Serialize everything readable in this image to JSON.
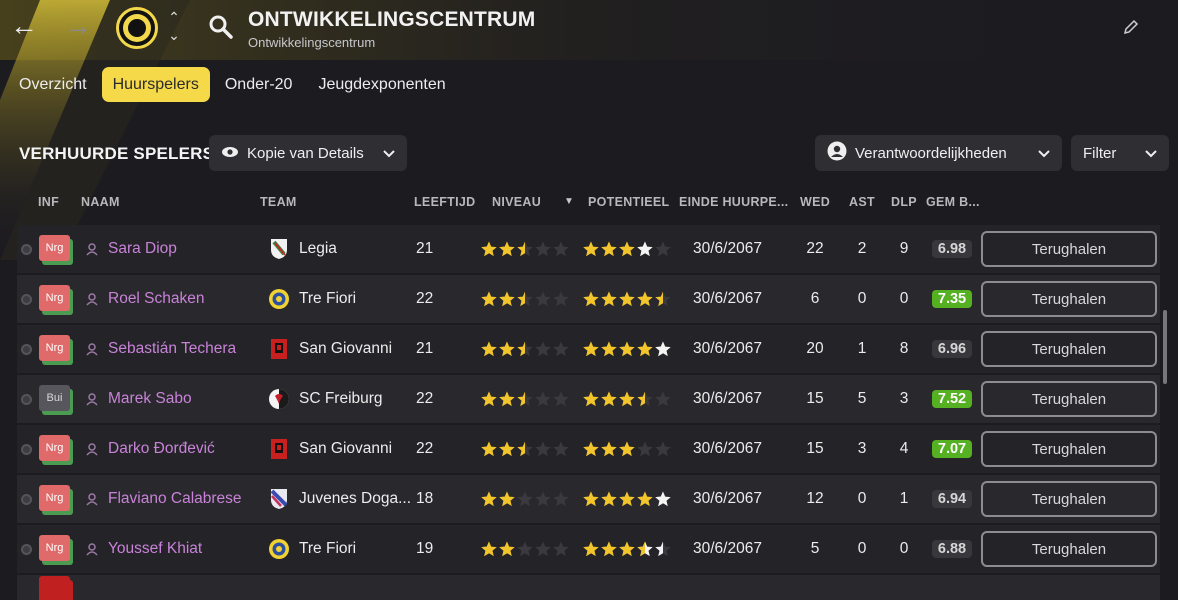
{
  "header": {
    "title": "ONTWIKKELINGSCENTRUM",
    "subtitle": "Ontwikkelingscentrum"
  },
  "tabs": [
    {
      "label": "Overzicht",
      "active": false
    },
    {
      "label": "Huurspelers",
      "active": true
    },
    {
      "label": "Onder-20",
      "active": false
    },
    {
      "label": "Jeugdexponenten",
      "active": false
    }
  ],
  "section": {
    "title": "VERHUURDE SPELERS",
    "view_label": "Kopie van Details",
    "responsibilities_label": "Verantwoordelijkheden",
    "filter_label": "Filter"
  },
  "columns": {
    "inf": "INF",
    "naam": "NAAM",
    "team": "TEAM",
    "leeftijd": "LEEFTIJD",
    "niveau": "NIVEAU",
    "potentieel": "POTENTIEEL",
    "einde": "EINDE HUURPE...",
    "wed": "WED",
    "ast": "AST",
    "dlp": "DLP",
    "gem": "GEM B..."
  },
  "recall_label": "Terughalen",
  "colors": {
    "accent": "#f5d949",
    "name": "#c883d8",
    "rating_good": "#55b022",
    "badge_red": "#e06a6a"
  },
  "players": [
    {
      "badge": "Nrg",
      "name": "Sara Diop",
      "team": "Legia",
      "crest": "legia-crest-icon",
      "age": "21",
      "niveau": 2.5,
      "potentieel": 4,
      "potentieel_base": 3,
      "date": "30/6/2067",
      "wed": "22",
      "ast": "2",
      "dlp": "9",
      "rating": "6.98",
      "good": false
    },
    {
      "badge": "Nrg",
      "name": "Roel Schaken",
      "team": "Tre Fiori",
      "crest": "tre-fiori-crest-icon",
      "age": "22",
      "niveau": 2.5,
      "potentieel": 4.5,
      "potentieel_base": 4.5,
      "date": "30/6/2067",
      "wed": "6",
      "ast": "0",
      "dlp": "0",
      "rating": "7.35",
      "good": true
    },
    {
      "badge": "Nrg",
      "name": "Sebastián Techera",
      "team": "San Giovanni",
      "crest": "san-giovanni-crest-icon",
      "age": "21",
      "niveau": 2.5,
      "potentieel": 5,
      "potentieel_base": 4,
      "date": "30/6/2067",
      "wed": "20",
      "ast": "1",
      "dlp": "8",
      "rating": "6.96",
      "good": false
    },
    {
      "badge": "Bui",
      "name": "Marek Sabo",
      "team": "SC Freiburg",
      "crest": "sc-freiburg-crest-icon",
      "age": "22",
      "niveau": 2.5,
      "potentieel": 3.5,
      "potentieel_base": 3.5,
      "date": "30/6/2067",
      "wed": "15",
      "ast": "5",
      "dlp": "3",
      "rating": "7.52",
      "good": true
    },
    {
      "badge": "Nrg",
      "name": "Darko Đorđević",
      "team": "San Giovanni",
      "crest": "san-giovanni-crest-icon",
      "age": "22",
      "niveau": 2.5,
      "potentieel": 3,
      "potentieel_base": 3,
      "date": "30/6/2067",
      "wed": "15",
      "ast": "3",
      "dlp": "4",
      "rating": "7.07",
      "good": true
    },
    {
      "badge": "Nrg",
      "name": "Flaviano Calabrese",
      "team": "Juvenes Doga...",
      "crest": "juvenes-dogana-crest-icon",
      "age": "18",
      "niveau": 2,
      "potentieel": 5,
      "potentieel_base": 4,
      "date": "30/6/2067",
      "wed": "12",
      "ast": "0",
      "dlp": "1",
      "rating": "6.94",
      "good": false
    },
    {
      "badge": "Nrg",
      "name": "Youssef Khiat",
      "team": "Tre Fiori",
      "crest": "tre-fiori-crest-icon",
      "age": "19",
      "niveau": 2,
      "potentieel": 4.5,
      "potentieel_base": 3.5,
      "date": "30/6/2067",
      "wed": "5",
      "ast": "0",
      "dlp": "0",
      "rating": "6.88",
      "good": false
    }
  ]
}
